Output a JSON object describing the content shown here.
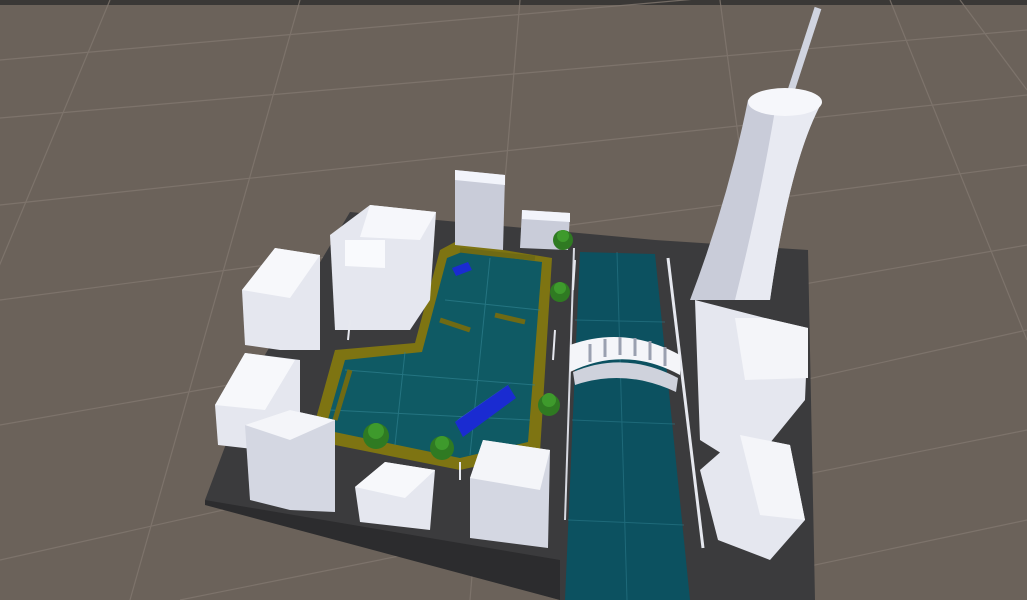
{
  "scene": {
    "view": "scene-view",
    "colors": {
      "ground": "#6b625a",
      "grid_line": "#82796f",
      "asphalt": "#3b3b3d",
      "water": "#0c5160",
      "pool_water": "#0f5a64",
      "pool_rim": "#7e7412",
      "building_light": "#f2f4fb",
      "building_mid": "#c9ccd9",
      "building_dark": "#9da1b3",
      "tree": "#2f7a22",
      "bus": "#1a2bd1",
      "bridge": "#f4f5f9",
      "rail": "#e6e8ef"
    },
    "objects": [
      {
        "name": "city-block-base",
        "kind": "terrain"
      },
      {
        "name": "canal-water",
        "kind": "water"
      },
      {
        "name": "park-pool",
        "kind": "water"
      },
      {
        "name": "arch-bridge",
        "kind": "bridge"
      },
      {
        "name": "tall-tower",
        "kind": "building"
      },
      {
        "name": "blue-bus",
        "kind": "vehicle"
      },
      {
        "name": "blue-car",
        "kind": "vehicle"
      },
      {
        "name": "tree",
        "kind": "vegetation",
        "count": 6
      },
      {
        "name": "building",
        "kind": "building",
        "count": 11
      }
    ]
  }
}
